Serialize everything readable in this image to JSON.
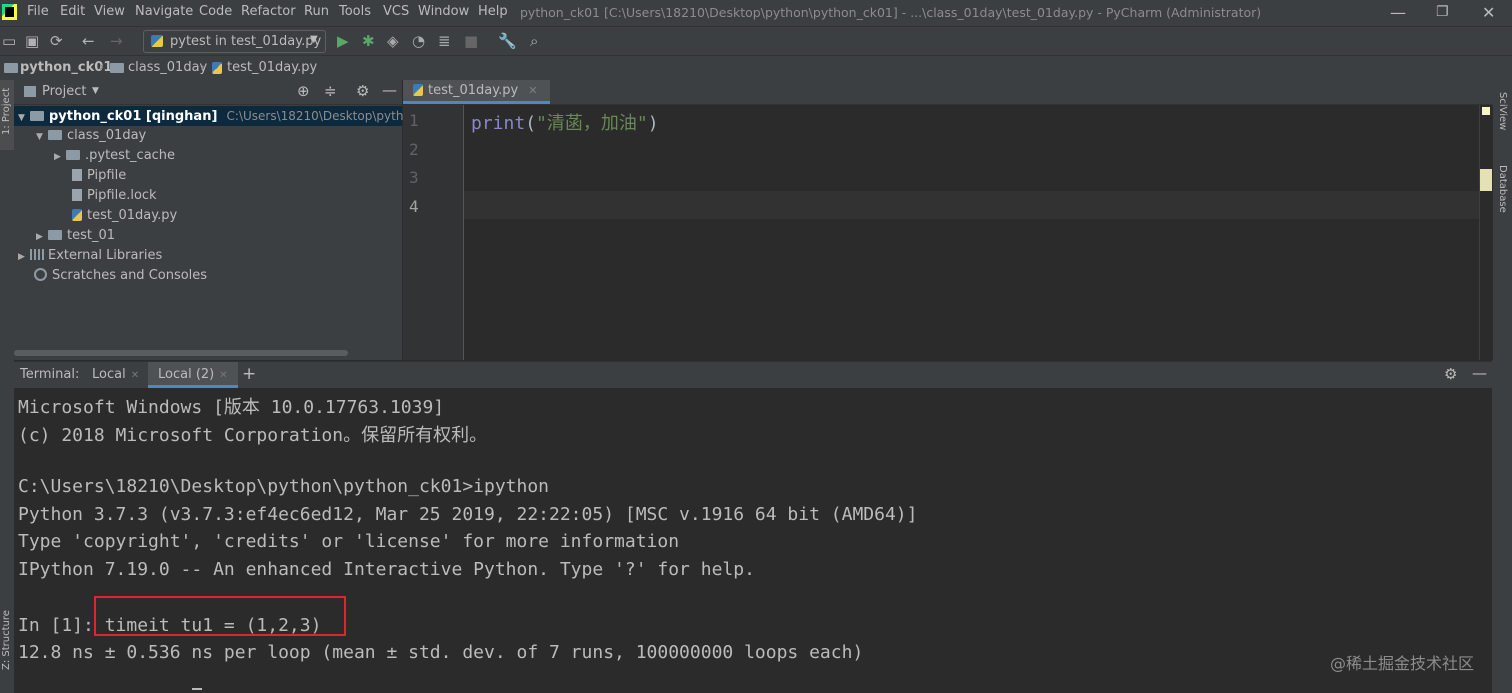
{
  "app": {
    "window_title": "python_ck01 [C:\\Users\\18210\\Desktop\\python\\python_ck01] - ...\\class_01day\\test_01day.py - PyCharm (Administrator)"
  },
  "menu": [
    "File",
    "Edit",
    "View",
    "Navigate",
    "Code",
    "Refactor",
    "Run",
    "Tools",
    "VCS",
    "Window",
    "Help"
  ],
  "toolbar": {
    "run_config": "pytest in test_01day.py"
  },
  "breadcrumb": [
    "python_ck01",
    "class_01day",
    "test_01day.py"
  ],
  "left_stripe": {
    "project": "1: Project",
    "structure": "Z: Structure"
  },
  "right_stripe": {
    "sciview": "SciView",
    "database": "Database"
  },
  "project_panel": {
    "title": "Project",
    "tree": [
      {
        "label": "python_ck01 [qinghan]",
        "path": "C:\\Users\\18210\\Desktop\\python\\py",
        "level": 0
      },
      {
        "label": "class_01day",
        "level": 1
      },
      {
        "label": ".pytest_cache",
        "level": 2
      },
      {
        "label": "Pipfile",
        "level": 2
      },
      {
        "label": "Pipfile.lock",
        "level": 2
      },
      {
        "label": "test_01day.py",
        "level": 2
      },
      {
        "label": "test_01",
        "level": 1
      },
      {
        "label": "External Libraries",
        "level": 0
      },
      {
        "label": "Scratches and Consoles",
        "level": 0
      }
    ]
  },
  "editor": {
    "tab": "test_01day.py",
    "line_numbers": [
      "1",
      "2",
      "3",
      "4"
    ],
    "code": {
      "func": "print",
      "open": "(",
      "string": "\"清菡，加油\"",
      "close": ")"
    }
  },
  "terminal": {
    "label": "Terminal:",
    "tabs": [
      "Local",
      "Local (2)"
    ],
    "lines": [
      "Microsoft Windows [版本 10.0.17763.1039]",
      "(c) 2018 Microsoft Corporation。保留所有权利。",
      "",
      "C:\\Users\\18210\\Desktop\\python\\python_ck01>ipython",
      "Python 3.7.3 (v3.7.3:ef4ec6ed12, Mar 25 2019, 22:22:05) [MSC v.1916 64 bit (AMD64)]",
      "Type 'copyright', 'credits' or 'license' for more information",
      "IPython 7.19.0 -- An enhanced Interactive Python. Type '?' for help.",
      "",
      "In [1]: timeit tu1 = (1,2,3)",
      "12.8 ns ± 0.536 ns per loop (mean ± std. dev. of 7 runs, 100000000 loops each)"
    ]
  },
  "watermark": "@稀土掘金技术社区",
  "colors": {
    "keyword": "#8888c6",
    "string": "#6a8759",
    "highlight": "#e0262d"
  }
}
